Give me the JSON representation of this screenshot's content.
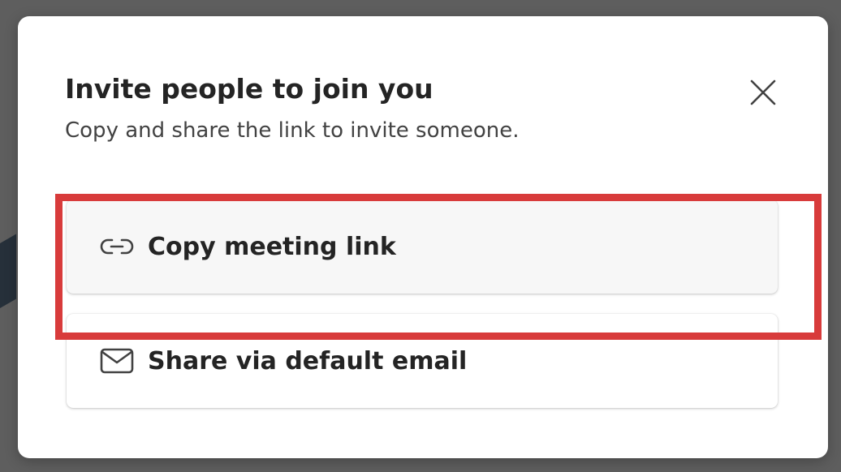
{
  "dialog": {
    "title": "Invite people to join you",
    "subtitle": "Copy and share the link to invite someone.",
    "close_icon": "close-icon"
  },
  "options": [
    {
      "label": "Copy meeting link",
      "icon": "link-icon",
      "highlighted": true
    },
    {
      "label": "Share via default email",
      "icon": "mail-icon",
      "highlighted": false
    }
  ],
  "colors": {
    "highlight": "#d83b3b",
    "text": "#242424",
    "backdrop": "#5e5e5e",
    "dialog_bg": "#ffffff",
    "hover_bg": "#f7f7f7"
  }
}
